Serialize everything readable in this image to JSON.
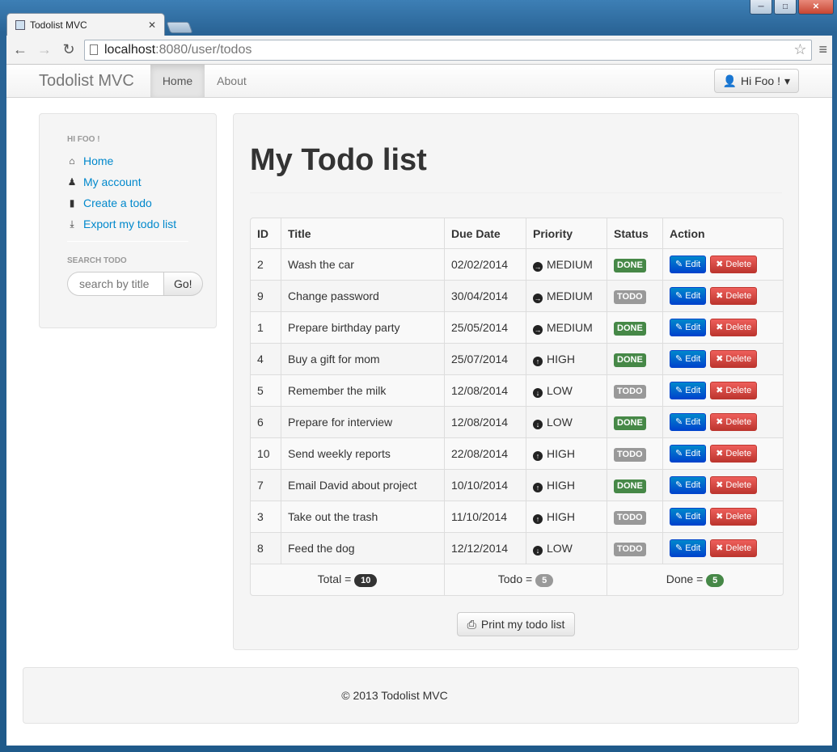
{
  "browser": {
    "tab_title": "Todolist MVC",
    "url_host": "localhost",
    "url_rest": ":8080/user/todos"
  },
  "navbar": {
    "brand": "Todolist MVC",
    "items": [
      {
        "label": "Home",
        "active": true
      },
      {
        "label": "About",
        "active": false
      }
    ],
    "user_label": "Hi Foo !"
  },
  "sidebar": {
    "header": "HI FOO !",
    "links": [
      {
        "label": "Home",
        "icon": "home-icon"
      },
      {
        "label": "My account",
        "icon": "user-icon"
      },
      {
        "label": "Create a todo",
        "icon": "file-icon"
      },
      {
        "label": "Export my todo list",
        "icon": "download-icon"
      }
    ],
    "search_header": "SEARCH TODO",
    "search_placeholder": "search by title",
    "search_button": "Go!"
  },
  "main": {
    "title": "My Todo list",
    "columns": [
      "ID",
      "Title",
      "Due Date",
      "Priority",
      "Status",
      "Action"
    ],
    "rows": [
      {
        "id": "2",
        "title": "Wash the car",
        "due": "02/02/2014",
        "priority": "MEDIUM",
        "status": "DONE"
      },
      {
        "id": "9",
        "title": "Change password",
        "due": "30/04/2014",
        "priority": "MEDIUM",
        "status": "TODO"
      },
      {
        "id": "1",
        "title": "Prepare birthday party",
        "due": "25/05/2014",
        "priority": "MEDIUM",
        "status": "DONE"
      },
      {
        "id": "4",
        "title": "Buy a gift for mom",
        "due": "25/07/2014",
        "priority": "HIGH",
        "status": "DONE"
      },
      {
        "id": "5",
        "title": "Remember the milk",
        "due": "12/08/2014",
        "priority": "LOW",
        "status": "TODO"
      },
      {
        "id": "6",
        "title": "Prepare for interview",
        "due": "12/08/2014",
        "priority": "LOW",
        "status": "DONE"
      },
      {
        "id": "10",
        "title": "Send weekly reports",
        "due": "22/08/2014",
        "priority": "HIGH",
        "status": "TODO"
      },
      {
        "id": "7",
        "title": "Email David about project",
        "due": "10/10/2014",
        "priority": "HIGH",
        "status": "DONE"
      },
      {
        "id": "3",
        "title": "Take out the trash",
        "due": "11/10/2014",
        "priority": "HIGH",
        "status": "TODO"
      },
      {
        "id": "8",
        "title": "Feed the dog",
        "due": "12/12/2014",
        "priority": "LOW",
        "status": "TODO"
      }
    ],
    "edit_label": "Edit",
    "delete_label": "Delete",
    "totals": {
      "total_label": "Total =",
      "total_count": "10",
      "todo_label": "Todo =",
      "todo_count": "5",
      "done_label": "Done =",
      "done_count": "5"
    },
    "print_label": "Print my todo list"
  },
  "footer": {
    "text": "© 2013 Todolist MVC"
  },
  "colors": {
    "link": "#0088cc",
    "done": "#468847",
    "todo": "#999999",
    "edit": "#0044cc",
    "delete": "#bd362f"
  }
}
